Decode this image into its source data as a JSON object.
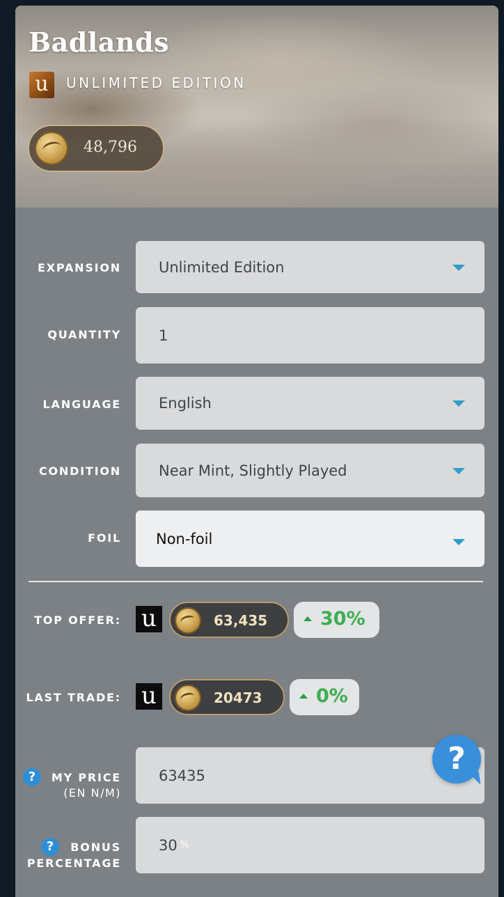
{
  "card": {
    "title": "Badlands",
    "set_symbol": "u",
    "set_name": "UNLIMITED EDITION",
    "balance": "48,796"
  },
  "form": {
    "expansion": {
      "label": "EXPANSION",
      "value": "Unlimited Edition"
    },
    "quantity": {
      "label": "QUANTITY",
      "value": "1"
    },
    "language": {
      "label": "LANGUAGE",
      "value": "English"
    },
    "condition": {
      "label": "CONDITION",
      "value": "Near Mint, Slightly Played"
    },
    "foil": {
      "label": "FOIL",
      "value": "Non-foil"
    }
  },
  "offers": {
    "top_offer": {
      "label": "TOP OFFER:",
      "set_symbol": "u",
      "price": "63,435",
      "change": "30%"
    },
    "last_trade": {
      "label": "LAST TRADE:",
      "set_symbol": "u",
      "price": "20473",
      "change": "0%"
    }
  },
  "pricing": {
    "my_price": {
      "label": "MY PRICE",
      "sublabel": "(EN N/M)",
      "value": "63435",
      "help": "?"
    },
    "bonus": {
      "label_line1": "BONUS",
      "label_line2": "PERCENTAGE",
      "value": "30",
      "suffix": "%",
      "help": "?"
    }
  },
  "help_button": {
    "label": "?"
  },
  "colors": {
    "accent_blue": "#2e9ec7",
    "positive_green": "#3eae52",
    "panel": "#7c8186"
  }
}
